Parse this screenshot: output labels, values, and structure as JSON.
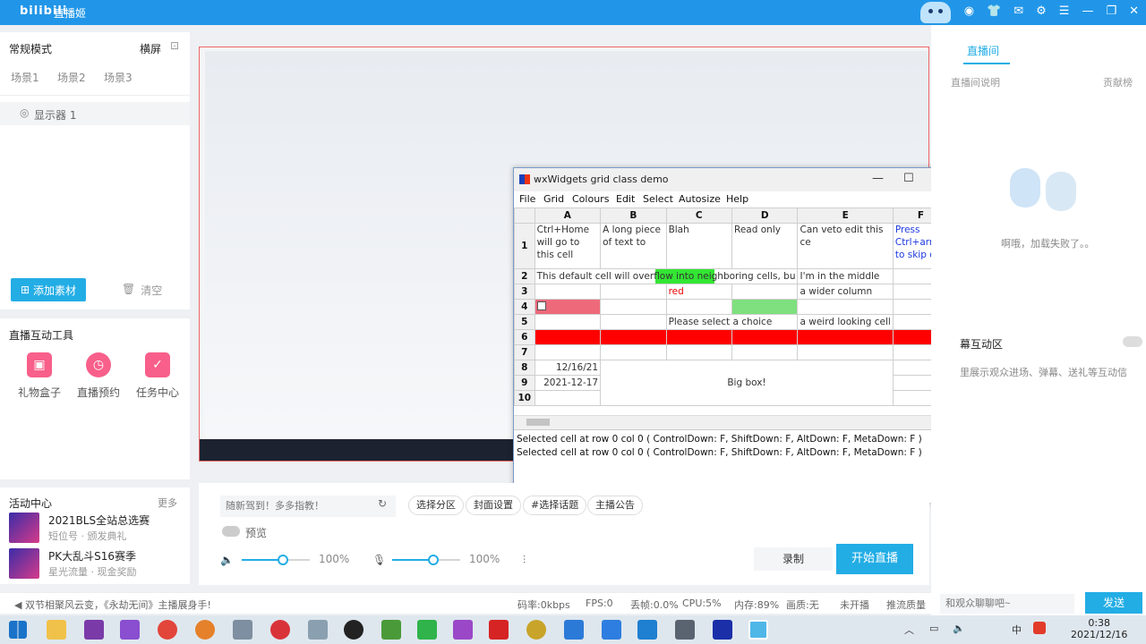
{
  "titlebar": {
    "logo": "bilibili",
    "app_name": "直播姬"
  },
  "left": {
    "mode": "常规模式",
    "orientation": "横屏",
    "scenes": [
      "场景1",
      "场景2",
      "场景3"
    ],
    "source": "显示器 1",
    "add_material": "添加素材",
    "clear": "清空"
  },
  "tools": {
    "title": "直播互动工具",
    "items": [
      {
        "label": "礼物盒子",
        "icon": "gift-icon"
      },
      {
        "label": "直播预约",
        "icon": "alarm-icon"
      },
      {
        "label": "任务中心",
        "icon": "task-icon"
      }
    ]
  },
  "activity": {
    "title": "活动中心",
    "more": "更多",
    "items": [
      {
        "title": "2021BLS全站总选赛",
        "sub": "短位号 · 颁发典礼"
      },
      {
        "title": "PK大乱斗S16赛季",
        "sub": "星光流量 · 现金奖励"
      }
    ]
  },
  "bottom": {
    "title_placeholder": "随新驾到！多多指教！",
    "chips": [
      "选择分区",
      "封面设置",
      "#选择话题",
      "主播公告"
    ],
    "preview": "预览",
    "speaker_pct": "100%",
    "mic_pct": "100%",
    "speaker_level": 0.6,
    "mic_level": 0.6,
    "record": "录制",
    "go_live": "开始直播"
  },
  "status": {
    "message": "◀ 双节相聚风云变，《永劫无间》主播展身手!",
    "bitrate": "码率:0kbps",
    "fps": "FPS:0",
    "drop": "丢帧:0.0%",
    "cpu": "CPU:5%",
    "mem": "内存:89%",
    "quality": "画质:无",
    "live": "未开播",
    "push": "推流质量"
  },
  "right": {
    "tab": "直播间",
    "sub1": "直播间说明",
    "sub2": "贡献榜",
    "load_fail": "啊哦，加载失败了。。",
    "interact_title": "幕互动区",
    "interact_desc": "里展示观众进场、弹幕、送礼等互动信",
    "danmu_placeholder": "和观众聊聊吧~",
    "send": "发送"
  },
  "wx": {
    "title": "wxWidgets grid class demo",
    "menus": [
      "File",
      "Grid",
      "Colours",
      "Edit",
      "Select",
      "Autosize",
      "Help"
    ],
    "columns": [
      "A",
      "B",
      "C",
      "D",
      "E",
      "F"
    ],
    "rows": [
      "1",
      "2",
      "3",
      "4",
      "5",
      "6",
      "7",
      "8",
      "9",
      "10"
    ],
    "cells": {
      "a1": "Ctrl+Home will go to this cell",
      "b1": "A long piece of text to",
      "c1": "Blah",
      "d1": "Read only",
      "e1": "Can veto edit this ce",
      "f1": "Press Ctrl+arrow to skip ov",
      "a2": "This default cell will overflow into neighboring cells, bu",
      "e2": "I'm in the middle",
      "c3": "red",
      "e3": "a wider column",
      "c5": "Please select a choice",
      "e5": "a weird looking cell",
      "a8": "12/16/21",
      "a9": "2021-12-17",
      "big": "Big box!"
    },
    "log": [
      "Selected cell at row 0 col 0 ( ControlDown: F, ShiftDown: F, AltDown: F, MetaDown: F )",
      "Selected cell at row 0 col 0 ( ControlDown: F, ShiftDown: F, AltDown: F, MetaDown: F )"
    ]
  },
  "taskbar": {
    "time": "0:38",
    "date": "2021/12/16",
    "ime": "中"
  },
  "colors": {
    "accent": "#23ade5",
    "titlebar": "#2196e8",
    "pink": "#f85f8a"
  }
}
